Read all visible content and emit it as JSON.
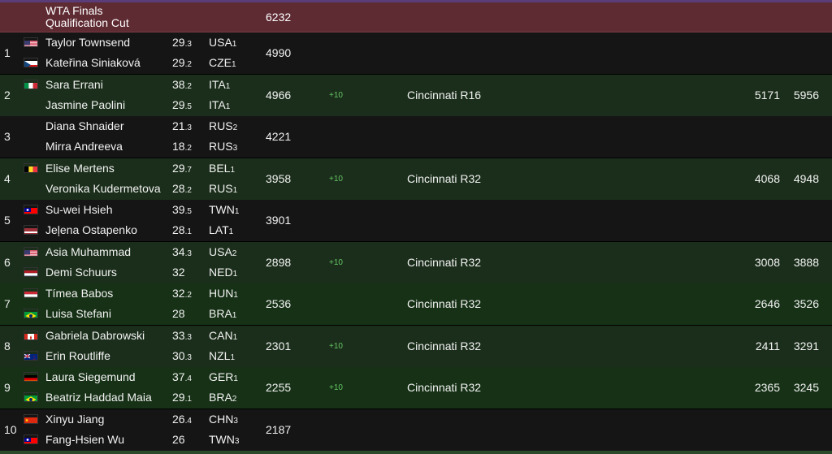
{
  "cutoff": {
    "label": "WTA Finals Qualification Cut",
    "points": "6232"
  },
  "teams": [
    {
      "rank": "1",
      "players": [
        {
          "name": "Taylor Townsend",
          "age": "29",
          "age_dec": ".3",
          "country": "USA",
          "country_num": "1",
          "flag": "usa"
        },
        {
          "name": "Kateřina Siniaková",
          "age": "29",
          "age_dec": ".2",
          "country": "CZE",
          "country_num": "1",
          "flag": "cze"
        }
      ],
      "points": "4990",
      "change": "",
      "event": "",
      "points_a": "",
      "points_b": ""
    },
    {
      "rank": "2",
      "players": [
        {
          "name": "Sara Errani",
          "age": "38",
          "age_dec": ".2",
          "country": "ITA",
          "country_num": "1",
          "flag": "ita"
        },
        {
          "name": "Jasmine Paolini",
          "age": "29",
          "age_dec": ".5",
          "country": "ITA",
          "country_num": "1",
          "flag": "none"
        }
      ],
      "points": "4966",
      "change": "+10",
      "event": "Cincinnati R16",
      "points_a": "5171",
      "points_b": "5956"
    },
    {
      "rank": "3",
      "players": [
        {
          "name": "Diana Shnaider",
          "age": "21",
          "age_dec": ".3",
          "country": "RUS",
          "country_num": "2",
          "flag": "none"
        },
        {
          "name": "Mirra Andreeva",
          "age": "18",
          "age_dec": ".2",
          "country": "RUS",
          "country_num": "3",
          "flag": "none"
        }
      ],
      "points": "4221",
      "change": "",
      "event": "",
      "points_a": "",
      "points_b": ""
    },
    {
      "rank": "4",
      "players": [
        {
          "name": "Elise Mertens",
          "age": "29",
          "age_dec": ".7",
          "country": "BEL",
          "country_num": "1",
          "flag": "bel"
        },
        {
          "name": "Veronika Kudermetova",
          "age": "28",
          "age_dec": ".2",
          "country": "RUS",
          "country_num": "1",
          "flag": "none"
        }
      ],
      "points": "3958",
      "change": "+10",
      "event": "Cincinnati R32",
      "points_a": "4068",
      "points_b": "4948"
    },
    {
      "rank": "5",
      "players": [
        {
          "name": "Su-wei Hsieh",
          "age": "39",
          "age_dec": ".5",
          "country": "TWN",
          "country_num": "1",
          "flag": "twn"
        },
        {
          "name": "Jeļena Ostapenko",
          "age": "28",
          "age_dec": ".1",
          "country": "LAT",
          "country_num": "1",
          "flag": "lat"
        }
      ],
      "points": "3901",
      "change": "",
      "event": "",
      "points_a": "",
      "points_b": ""
    },
    {
      "rank": "6",
      "players": [
        {
          "name": "Asia Muhammad",
          "age": "34",
          "age_dec": ".3",
          "country": "USA",
          "country_num": "2",
          "flag": "usa"
        },
        {
          "name": "Demi Schuurs",
          "age": "32",
          "age_dec": "",
          "country": "NED",
          "country_num": "1",
          "flag": "ned"
        }
      ],
      "points": "2898",
      "change": "+10",
      "event": "Cincinnati R32",
      "points_a": "3008",
      "points_b": "3888"
    },
    {
      "rank": "7",
      "players": [
        {
          "name": "Tímea Babos",
          "age": "32",
          "age_dec": ".2",
          "country": "HUN",
          "country_num": "1",
          "flag": "hun"
        },
        {
          "name": "Luisa Stefani",
          "age": "28",
          "age_dec": "",
          "country": "BRA",
          "country_num": "1",
          "flag": "bra"
        }
      ],
      "points": "2536",
      "change": "",
      "event": "Cincinnati R32",
      "points_a": "2646",
      "points_b": "3526"
    },
    {
      "rank": "8",
      "players": [
        {
          "name": "Gabriela Dabrowski",
          "age": "33",
          "age_dec": ".3",
          "country": "CAN",
          "country_num": "1",
          "flag": "can"
        },
        {
          "name": "Erin Routliffe",
          "age": "30",
          "age_dec": ".3",
          "country": "NZL",
          "country_num": "1",
          "flag": "nzl"
        }
      ],
      "points": "2301",
      "change": "+10",
      "event": "Cincinnati R32",
      "points_a": "2411",
      "points_b": "3291"
    },
    {
      "rank": "9",
      "players": [
        {
          "name": "Laura Siegemund",
          "age": "37",
          "age_dec": ".4",
          "country": "GER",
          "country_num": "1",
          "flag": "ger"
        },
        {
          "name": "Beatriz Haddad Maia",
          "age": "29",
          "age_dec": ".1",
          "country": "BRA",
          "country_num": "2",
          "flag": "bra"
        }
      ],
      "points": "2255",
      "change": "+10",
      "event": "Cincinnati R32",
      "points_a": "2365",
      "points_b": "3245"
    },
    {
      "rank": "10",
      "players": [
        {
          "name": "Xinyu Jiang",
          "age": "26",
          "age_dec": ".4",
          "country": "CHN",
          "country_num": "3",
          "flag": "chn"
        },
        {
          "name": "Fang-Hsien Wu",
          "age": "26",
          "age_dec": "",
          "country": "TWN",
          "country_num": "3",
          "flag": "twn"
        }
      ],
      "points": "2187",
      "change": "",
      "event": "",
      "points_a": "",
      "points_b": ""
    }
  ],
  "colors": {
    "cut_row_bg": "#5e2b33",
    "green_row_bg": "#1b2e1b",
    "dark_row_bg": "#151515",
    "change_positive": "#64c464",
    "top_accent": "#5a3c79"
  }
}
